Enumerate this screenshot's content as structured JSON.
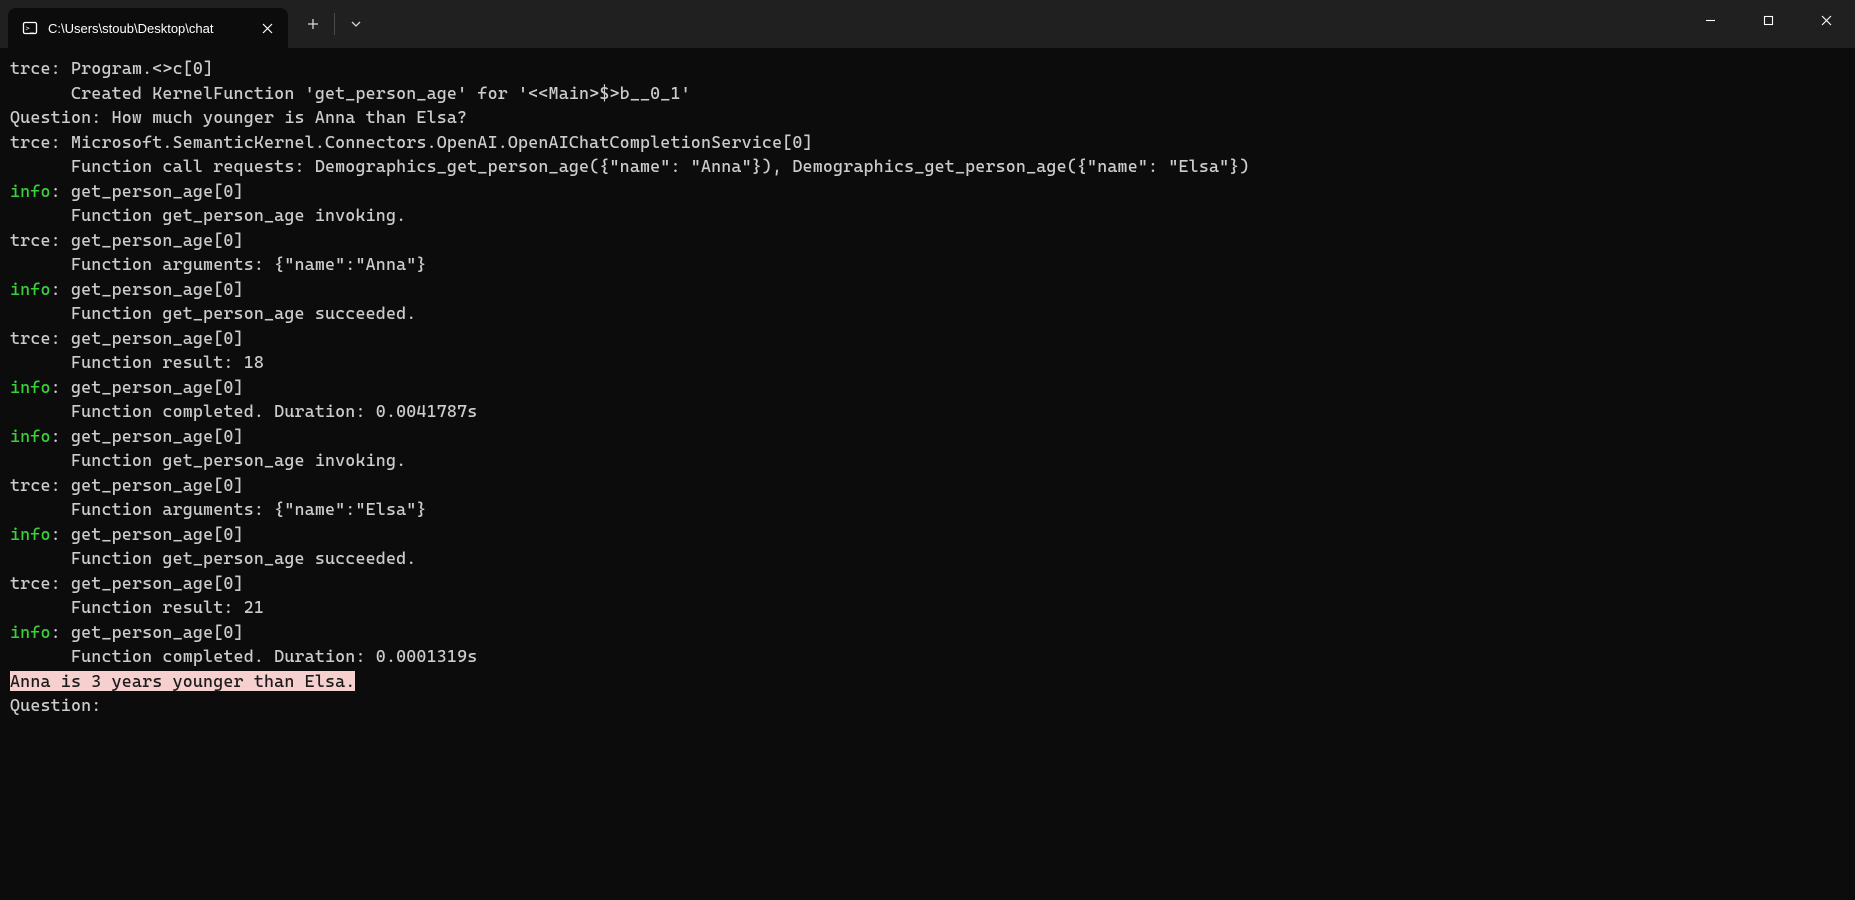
{
  "titlebar": {
    "tab_title": "C:\\Users\\stoub\\Desktop\\chat",
    "new_tab_tooltip": "+",
    "dropdown": "v"
  },
  "lines": [
    {
      "level": "trce",
      "head": "Program.<>c[0]"
    },
    {
      "level": null,
      "body": "      Created KernelFunction 'get_person_age' for '<<Main>$>b__0_1'"
    },
    {
      "level": null,
      "body": "Question: How much younger is Anna than Elsa?"
    },
    {
      "level": "trce",
      "head": "Microsoft.SemanticKernel.Connectors.OpenAI.OpenAIChatCompletionService[0]"
    },
    {
      "level": null,
      "body": "      Function call requests: Demographics_get_person_age({\"name\": \"Anna\"}), Demographics_get_person_age({\"name\": \"Elsa\"})"
    },
    {
      "level": "info",
      "head": "get_person_age[0]"
    },
    {
      "level": null,
      "body": "      Function get_person_age invoking."
    },
    {
      "level": "trce",
      "head": "get_person_age[0]"
    },
    {
      "level": null,
      "body": "      Function arguments: {\"name\":\"Anna\"}"
    },
    {
      "level": "info",
      "head": "get_person_age[0]"
    },
    {
      "level": null,
      "body": "      Function get_person_age succeeded."
    },
    {
      "level": "trce",
      "head": "get_person_age[0]"
    },
    {
      "level": null,
      "body": "      Function result: 18"
    },
    {
      "level": "info",
      "head": "get_person_age[0]"
    },
    {
      "level": null,
      "body": "      Function completed. Duration: 0.0041787s"
    },
    {
      "level": "info",
      "head": "get_person_age[0]"
    },
    {
      "level": null,
      "body": "      Function get_person_age invoking."
    },
    {
      "level": "trce",
      "head": "get_person_age[0]"
    },
    {
      "level": null,
      "body": "      Function arguments: {\"name\":\"Elsa\"}"
    },
    {
      "level": "info",
      "head": "get_person_age[0]"
    },
    {
      "level": null,
      "body": "      Function get_person_age succeeded."
    },
    {
      "level": "trce",
      "head": "get_person_age[0]"
    },
    {
      "level": null,
      "body": "      Function result: 21"
    },
    {
      "level": "info",
      "head": "get_person_age[0]"
    },
    {
      "level": null,
      "body": "      Function completed. Duration: 0.0001319s"
    },
    {
      "level": null,
      "highlight": true,
      "body": "Anna is 3 years younger than Elsa."
    },
    {
      "level": null,
      "body": "Question:"
    }
  ]
}
